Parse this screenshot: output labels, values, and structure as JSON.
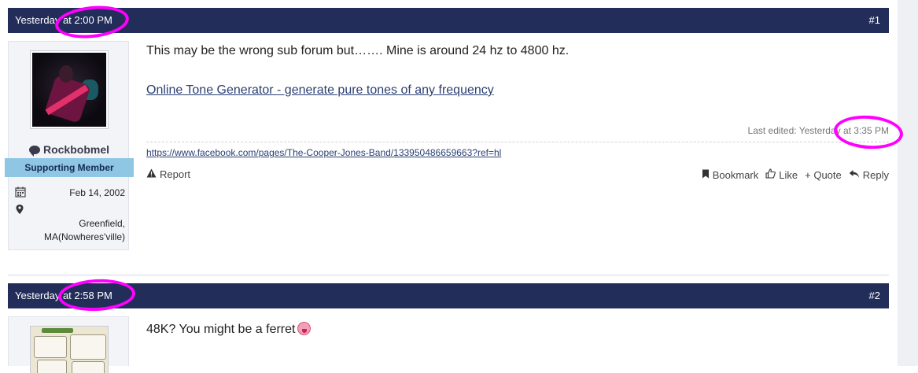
{
  "posts": [
    {
      "date": "Yesterday at 2:00 PM",
      "number": "#1",
      "author": {
        "username": "Rockbobmel",
        "title": "Supporting Member",
        "joined": "Feb 14, 2002",
        "location": "Greenfield, MA(Nowheres'ville)"
      },
      "body": {
        "text": "This may be the wrong sub forum but……. Mine is around 24 hz to 4800 hz.",
        "link": "Online Tone Generator - generate pure tones of any frequency"
      },
      "last_edited": "Last edited: Yesterday at 3:35 PM",
      "signature": "https://www.facebook.com/pages/The-Cooper-Jones-Band/133950486659663?ref=hl",
      "actions": {
        "report": "Report",
        "bookmark": "Bookmark",
        "like": "Like",
        "quote": "+ Quote",
        "reply": "Reply"
      }
    },
    {
      "date": "Yesterday at 2:58 PM",
      "number": "#2",
      "body": {
        "text": "48K? You might be a ferret"
      }
    }
  ],
  "icons": {
    "chat": "chat-bubble-icon",
    "calendar": "calendar-icon",
    "location": "map-marker-icon",
    "report": "warning-icon",
    "bookmark": "bookmark-icon",
    "like": "thumbs-up-icon",
    "reply": "reply-icon",
    "emoji": "tongue-out-emoji-icon"
  },
  "colors": {
    "header_bg": "#232d59",
    "usertitle_bg": "#8fc6e4",
    "link": "#2b3f74",
    "annotation": "#ff00ff"
  }
}
